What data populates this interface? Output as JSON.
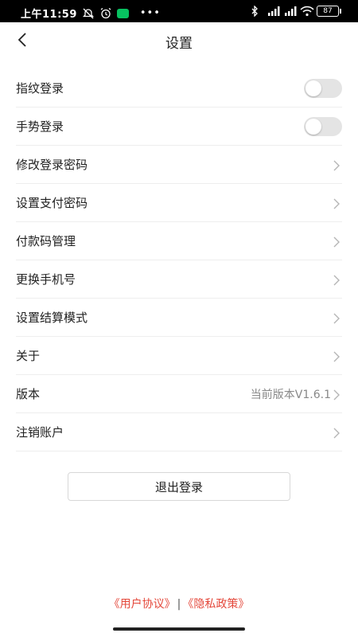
{
  "status_bar": {
    "time": "上午11:59",
    "dots": "•••",
    "battery": "87",
    "icons": [
      "alarm-off-icon",
      "alarm-icon",
      "wechat-icon",
      "bluetooth-icon",
      "signal-icon",
      "wifi-icon",
      "battery-icon"
    ]
  },
  "header": {
    "title": "设置",
    "back_icon": "back-arrow-icon"
  },
  "settings": {
    "items": [
      {
        "label": "指纹登录",
        "type": "toggle",
        "on": false
      },
      {
        "label": "手势登录",
        "type": "toggle",
        "on": false
      },
      {
        "label": "修改登录密码",
        "type": "link"
      },
      {
        "label": "设置支付密码",
        "type": "link"
      },
      {
        "label": "付款码管理",
        "type": "link"
      },
      {
        "label": "更换手机号",
        "type": "link"
      },
      {
        "label": "设置结算模式",
        "type": "link"
      },
      {
        "label": "关于",
        "type": "link"
      },
      {
        "label": "版本",
        "type": "link",
        "value": "当前版本V1.6.1"
      },
      {
        "label": "注销账户",
        "type": "link"
      }
    ]
  },
  "logout": {
    "label": "退出登录"
  },
  "footer": {
    "user_agreement": "《用户协议》",
    "separator": "|",
    "privacy_policy": "《隐私政策》"
  },
  "colors": {
    "accent_link": "#e4483b",
    "toggle_off": "#e4e4e4",
    "divider": "#eeeeee"
  }
}
